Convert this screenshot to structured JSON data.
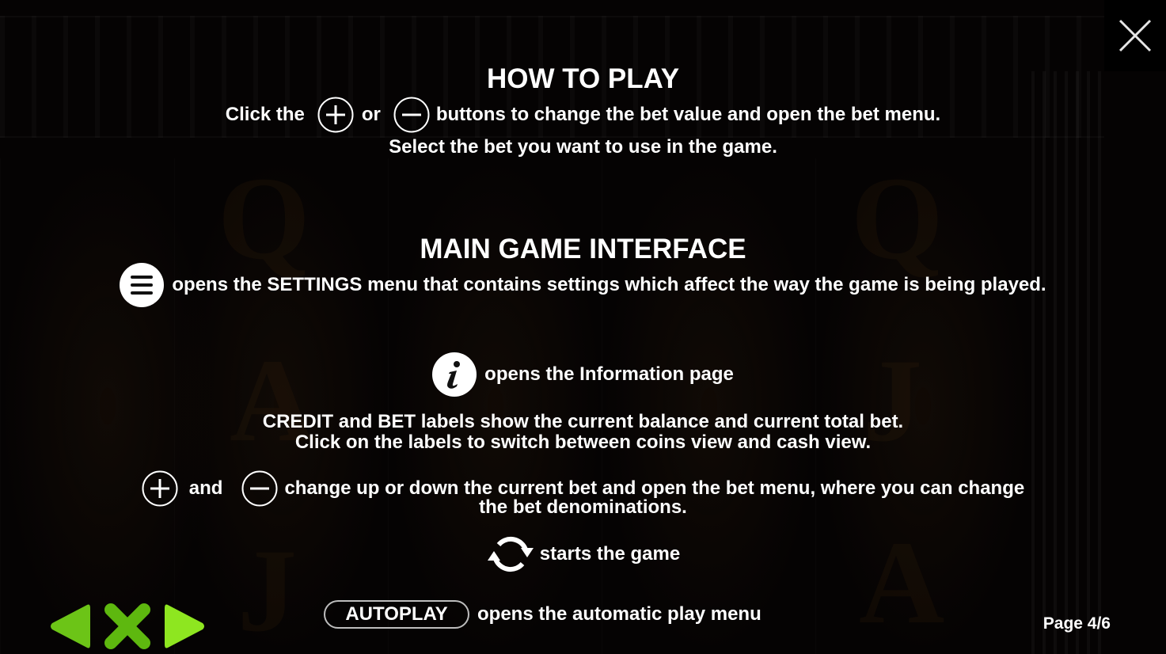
{
  "close_button": {
    "icon": "close-icon"
  },
  "how_to_play": {
    "title": "HOW TO PLAY",
    "line1": {
      "pre": "Click the",
      "mid": "or",
      "post": "buttons to change the bet value and open the bet menu."
    },
    "line2": "Select the bet you want to use in the game."
  },
  "main_interface": {
    "title": "MAIN GAME INTERFACE",
    "settings_text": "opens the SETTINGS menu that contains settings which affect the way the game is being played.",
    "info_text": "opens the Information page",
    "credit_line1": "CREDIT and BET labels show the current balance and current total bet.",
    "credit_line2": "Click on the labels to switch between coins view and cash view.",
    "bet_and": "and",
    "bet_line1": "change up or down the current bet and open the bet menu, where you can change",
    "bet_line2": "the bet denominations.",
    "spin_text": "starts the game",
    "autoplay_label": "AUTOPLAY",
    "autoplay_text": "opens the automatic play menu"
  },
  "footer": {
    "page_label": "Page 4/6",
    "nav_color": "#6cc417",
    "nav_color_light": "#8ee620"
  }
}
